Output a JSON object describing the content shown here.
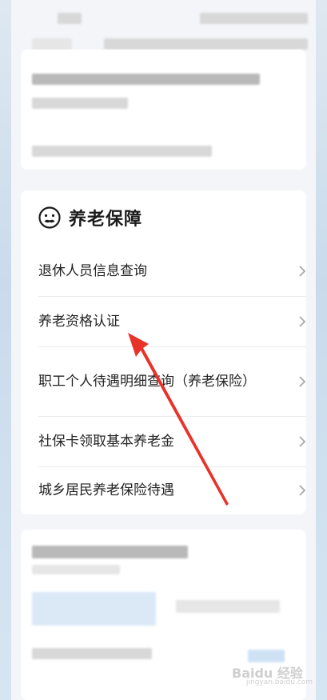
{
  "section": {
    "title": "养老保障",
    "icon": "face-icon"
  },
  "menu": [
    {
      "label": "退休人员信息查询",
      "icon": "chevron-right-icon"
    },
    {
      "label": "养老资格认证",
      "icon": "chevron-right-icon"
    },
    {
      "label": "职工个人待遇明细查询（养老保险）",
      "icon": "chevron-right-icon"
    },
    {
      "label": "社保卡领取基本养老金",
      "icon": "chevron-right-icon"
    },
    {
      "label": "城乡居民养老保险待遇",
      "icon": "chevron-right-icon"
    }
  ],
  "annotation": {
    "color": "#e8332b",
    "icon": "red-arrow-annotation"
  },
  "watermark": {
    "brand": "Baidu 经验",
    "url": "jingyan.baidu.com"
  }
}
